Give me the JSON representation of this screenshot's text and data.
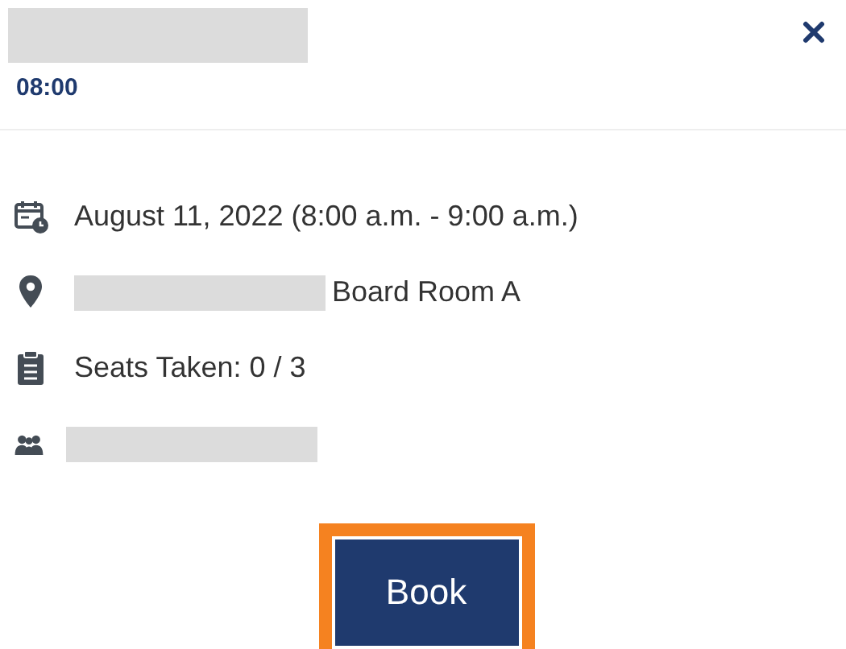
{
  "header": {
    "title_redacted": true,
    "time": "08:00"
  },
  "details": [
    {
      "kind": "date",
      "redacted": false,
      "text": "August 11, 2022 (8:00 a.m. - 9:00 a.m.)"
    },
    {
      "kind": "location",
      "redacted": true,
      "text": "Board Room A"
    },
    {
      "kind": "seats",
      "redacted": false,
      "text": "Seats Taken: 0 / 3"
    },
    {
      "kind": "attendees",
      "redacted": true
    }
  ],
  "button": {
    "label": "Book",
    "highlighted": true
  }
}
